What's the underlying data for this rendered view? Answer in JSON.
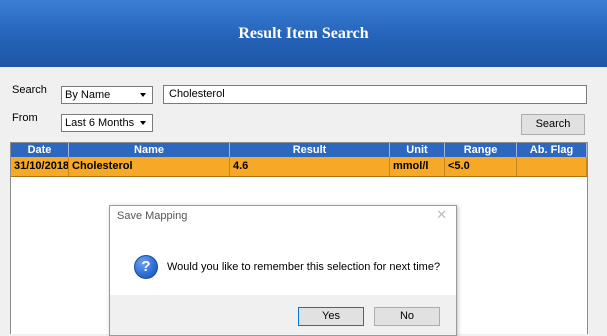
{
  "header": {
    "title": "Result Item Search"
  },
  "search": {
    "label": "Search",
    "by_value": "By Name",
    "query": "Cholesterol",
    "from_label": "From",
    "from_value": "Last 6 Months",
    "search_button": "Search"
  },
  "grid": {
    "columns": [
      "Date",
      "Name",
      "Result",
      "Unit",
      "Range",
      "Ab. Flag"
    ],
    "rows": [
      {
        "date": "31/10/2018",
        "name": "Cholesterol",
        "result": "4.6",
        "unit": "mmol/l",
        "range": "<5.0",
        "flag": ""
      }
    ],
    "row_highlight_color": "#f6a827",
    "header_color": "#2d68c0"
  },
  "dialog": {
    "title": "Save Mapping",
    "message": "Would you like to remember this selection for next time?",
    "icon": "question-icon",
    "yes": "Yes",
    "no": "No"
  }
}
